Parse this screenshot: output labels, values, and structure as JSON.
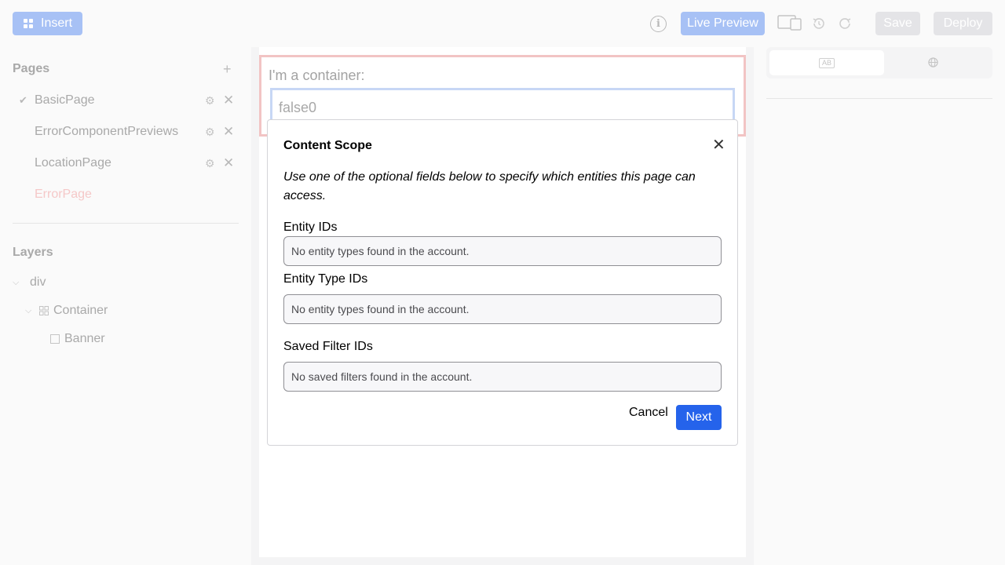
{
  "toolbar": {
    "insert_label": "Insert",
    "live_preview_label": "Live Preview",
    "save_label": "Save",
    "deploy_label": "Deploy",
    "info_icon": "i"
  },
  "sidebar": {
    "pages_title": "Pages",
    "add_icon": "+",
    "pages": [
      {
        "name": "BasicPage",
        "active": true
      },
      {
        "name": "ErrorComponentPreviews",
        "active": false
      },
      {
        "name": "LocationPage",
        "active": false
      },
      {
        "name": "ErrorPage",
        "active": false,
        "error": true
      }
    ],
    "layers_title": "Layers",
    "layers": [
      {
        "name": "div",
        "depth": 0
      },
      {
        "name": "Container",
        "depth": 1
      },
      {
        "name": "Banner",
        "depth": 2
      }
    ]
  },
  "canvas": {
    "container_label": "I'm a container:",
    "container_value": "false0"
  },
  "right_panel": {
    "tab_ab_label": "AB"
  },
  "modal": {
    "title": "Content Scope",
    "description": "Use one of the optional fields below to specify which entities this page can access.",
    "fields": [
      {
        "label": "Entity IDs",
        "placeholder": "No entity types found in the account."
      },
      {
        "label": "Entity Type IDs",
        "placeholder": "No entity types found in the account."
      },
      {
        "label": "Saved Filter IDs",
        "placeholder": "No saved filters found in the account."
      }
    ],
    "cancel_label": "Cancel",
    "next_label": "Next"
  },
  "colors": {
    "primary": "#2563eb",
    "primary_disabled": "#a7c1f5",
    "error_page": "#f5c8c8"
  }
}
